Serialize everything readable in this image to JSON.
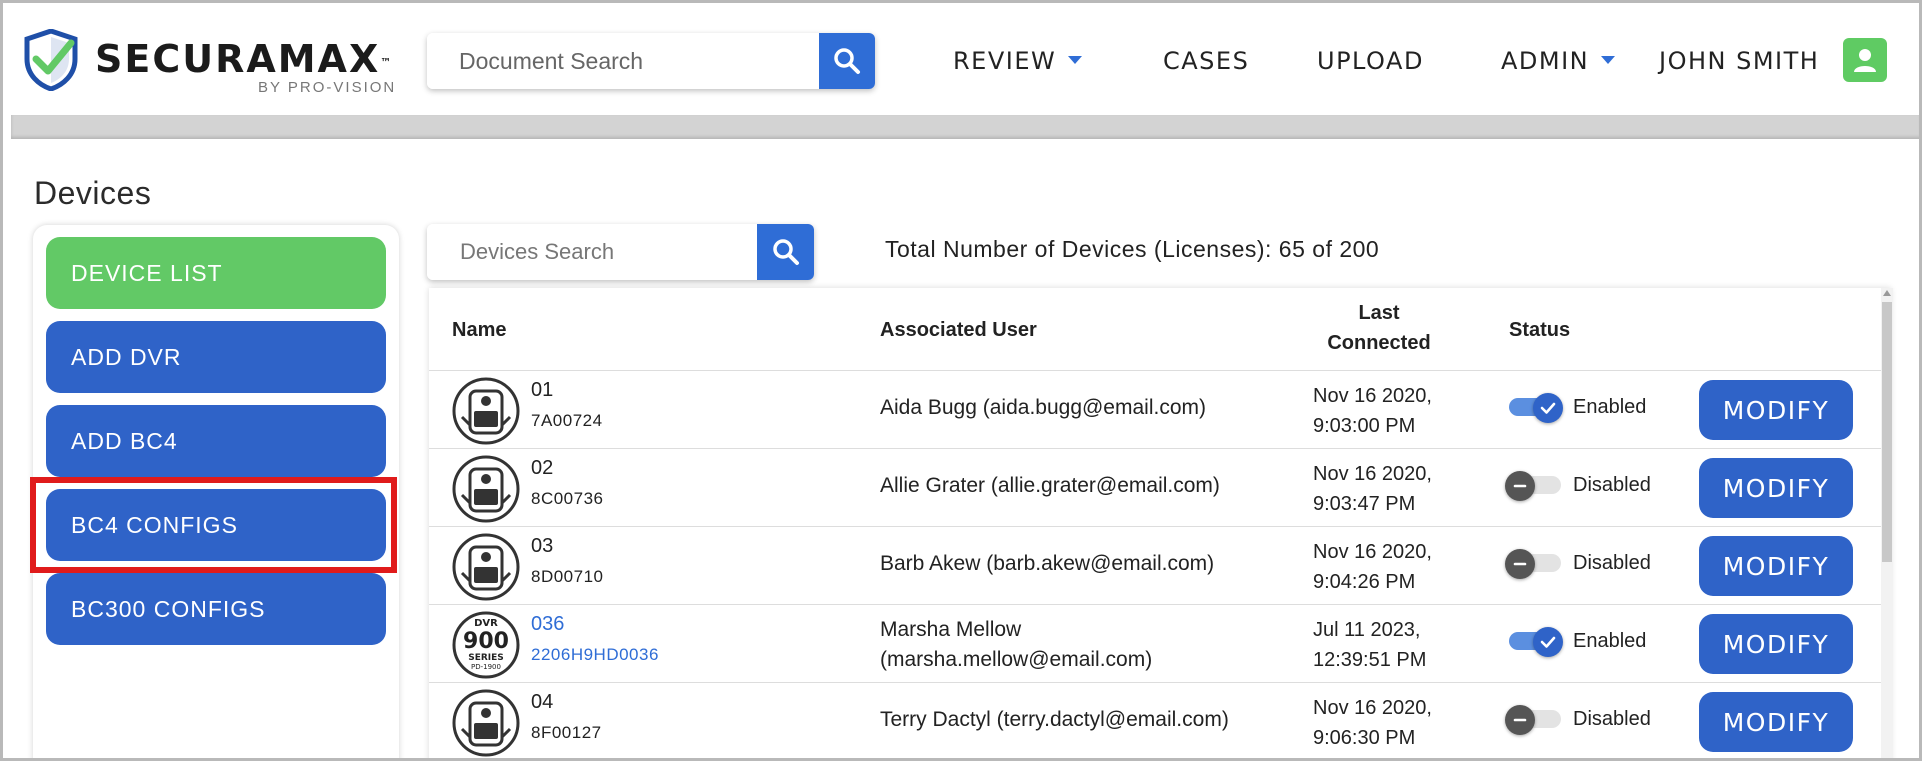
{
  "app": {
    "logo_text": "SECURAMAX",
    "logo_tm": "™",
    "logo_subtitle": "BY PRO-VISION"
  },
  "header": {
    "search_placeholder": "Document Search",
    "nav": [
      {
        "label": "REVIEW",
        "has_dropdown": true
      },
      {
        "label": "CASES",
        "has_dropdown": false
      },
      {
        "label": "UPLOAD",
        "has_dropdown": false
      },
      {
        "label": "ADMIN",
        "has_dropdown": true
      }
    ],
    "user_name": "JOHN SMITH"
  },
  "page": {
    "title": "Devices"
  },
  "sidebar": {
    "items": [
      {
        "label": "DEVICE LIST",
        "active": true
      },
      {
        "label": "ADD DVR",
        "active": false
      },
      {
        "label": "ADD BC4",
        "active": false
      },
      {
        "label": "BC4 CONFIGS",
        "active": false,
        "highlighted": true
      },
      {
        "label": "BC300 CONFIGS",
        "active": false
      }
    ]
  },
  "devices": {
    "search_placeholder": "Devices Search",
    "total_label": "Total Number of Devices (Licenses): 65 of 200"
  },
  "table": {
    "headers": {
      "name": "Name",
      "associated_user": "Associated User",
      "last_connected_1": "Last",
      "last_connected_2": "Connected",
      "status": "Status"
    },
    "modify_label": "MODIFY",
    "rows": [
      {
        "name": "01",
        "serial": "7A00724",
        "user": "Aida Bugg (aida.bugg@email.com)",
        "user_line2": "",
        "date": "Nov 16 2020,",
        "time": "9:03:00 PM",
        "status": "Enabled",
        "enabled": true,
        "icon": "body-camera-icon",
        "link": false
      },
      {
        "name": "02",
        "serial": "8C00736",
        "user": "Allie Grater (allie.grater@email.com)",
        "user_line2": "",
        "date": "Nov 16 2020,",
        "time": "9:03:47 PM",
        "status": "Disabled",
        "enabled": false,
        "icon": "body-camera-icon",
        "link": false
      },
      {
        "name": "03",
        "serial": "8D00710",
        "user": "Barb Akew (barb.akew@email.com)",
        "user_line2": "",
        "date": "Nov 16 2020,",
        "time": "9:04:26 PM",
        "status": "Disabled",
        "enabled": false,
        "icon": "body-camera-icon",
        "link": false
      },
      {
        "name": "036",
        "serial": "2206H9HD0036",
        "user": "Marsha Mellow",
        "user_line2": "(marsha.mellow@email.com)",
        "date": "Jul 11 2023,",
        "time": "12:39:51 PM",
        "status": "Enabled",
        "enabled": true,
        "icon": "dvr-900-icon",
        "link": true
      },
      {
        "name": "04",
        "serial": "8F00127",
        "user": "Terry Dactyl (terry.dactyl@email.com)",
        "user_line2": "",
        "date": "Nov 16 2020,",
        "time": "9:06:30 PM",
        "status": "Disabled",
        "enabled": false,
        "icon": "body-camera-icon",
        "link": false
      }
    ]
  },
  "dvr_badge": {
    "top": "DVR",
    "number": "900",
    "series": "SERIES",
    "model": "PD-1900"
  },
  "colors": {
    "primary_blue": "#2f63c8",
    "active_green": "#62c966",
    "highlight_red": "#e01b1b",
    "link_blue": "#2f6dd6"
  }
}
